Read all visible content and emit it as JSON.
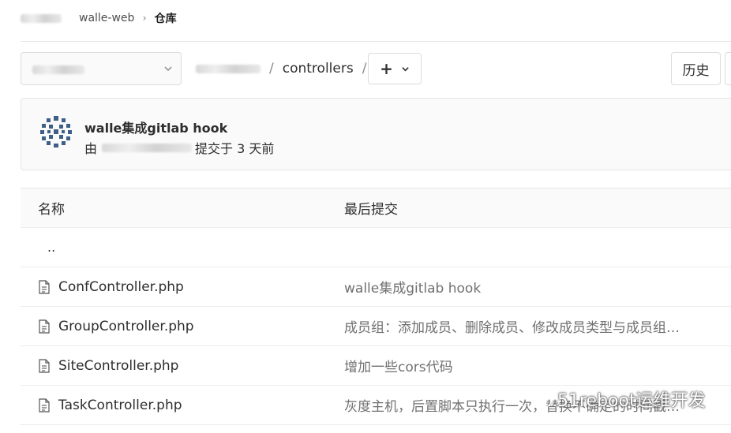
{
  "breadcrumb": {
    "project": "walle-web",
    "separator": "›",
    "current": "仓库"
  },
  "toolbar": {
    "path": [
      {
        "label": "controllers"
      }
    ],
    "path_separator": "/",
    "add_symbol": "+",
    "history_label": "历史"
  },
  "last_commit": {
    "title": "walle集成gitlab hook",
    "by_prefix": "由",
    "suffix": "提交于 3 天前"
  },
  "table": {
    "headers": {
      "name": "名称",
      "last_commit": "最后提交"
    },
    "parent_link": "..",
    "rows": [
      {
        "name": "ConfController.php",
        "commit": "walle集成gitlab hook",
        "icon": "file-icon"
      },
      {
        "name": "GroupController.php",
        "commit": "成员组：添加成员、删除成员、修改成员类型与成员组…",
        "icon": "file-icon"
      },
      {
        "name": "SiteController.php",
        "commit": "增加一些cors代码",
        "icon": "file-icon"
      },
      {
        "name": "TaskController.php",
        "commit": "灰度主机，后置脚本只执行一次，替换不确定的时间戳…",
        "icon": "file-icon"
      }
    ]
  },
  "watermark": {
    "text": "51reboot运维开发",
    "icon": "wechat-icon"
  },
  "colors": {
    "border": "#dcdcdc",
    "muted_text": "#707070",
    "row_divider": "#ececec",
    "panel_bg": "#fafafa"
  }
}
